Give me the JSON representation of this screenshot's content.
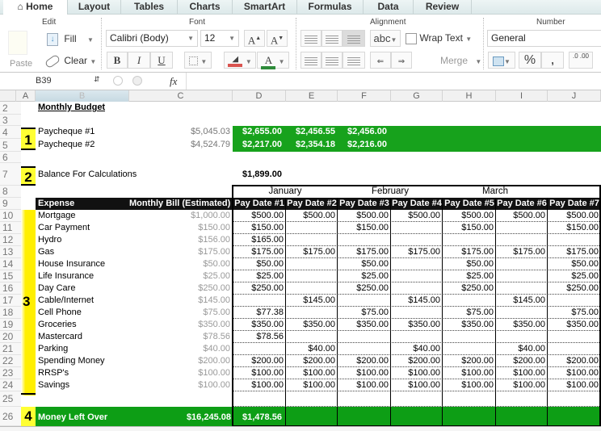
{
  "tabs": [
    {
      "label": "Home",
      "icon": "home-icon",
      "active": true
    },
    {
      "label": "Layout"
    },
    {
      "label": "Tables"
    },
    {
      "label": "Charts"
    },
    {
      "label": "SmartArt"
    },
    {
      "label": "Formulas"
    },
    {
      "label": "Data"
    },
    {
      "label": "Review"
    }
  ],
  "ribbon": {
    "edit": {
      "title": "Edit",
      "paste": "Paste",
      "fill": "Fill",
      "clear": "Clear"
    },
    "font": {
      "title": "Font",
      "font_name": "Calibri (Body)",
      "font_size": "12",
      "bold": "B",
      "italic": "I",
      "underline": "U",
      "grow": "A",
      "shrink": "A",
      "font_color": "A",
      "fill_color_hex": "#d9534f",
      "font_color_hex": "#2e8b3a"
    },
    "alignment": {
      "title": "Alignment",
      "orientation": "abc",
      "wrap_text": "Wrap Text",
      "merge": "Merge"
    },
    "number": {
      "title": "Number",
      "format": "General",
      "percent": "%",
      "comma": ",",
      "increase_decimal": ".0 .00"
    }
  },
  "formula_bar": {
    "name_box": "B39",
    "fx": "fx",
    "formula": ""
  },
  "columns": [
    "A",
    "B",
    "C",
    "D",
    "E",
    "F",
    "G",
    "H",
    "I",
    "J"
  ],
  "rows": [
    "2",
    "3",
    "4",
    "5",
    "6",
    "7",
    "8",
    "9",
    "10",
    "11",
    "12",
    "13",
    "14",
    "15",
    "16",
    "17",
    "18",
    "19",
    "20",
    "21",
    "22",
    "23",
    "24",
    "25",
    "26"
  ],
  "sheet": {
    "title": "Monthly Budget",
    "badges": [
      "1",
      "2",
      "3",
      "4"
    ],
    "paycheques": [
      {
        "label": "Paycheque #1",
        "total": "$5,045.03",
        "values": [
          "$2,655.00",
          "$2,456.55",
          "$2,456.00"
        ]
      },
      {
        "label": "Paycheque #2",
        "total": "$4,524.79",
        "values": [
          "$2,217.00",
          "$2,354.18",
          "$2,216.00"
        ]
      }
    ],
    "balance": {
      "label": "Balance For Calculations",
      "value": "$1,899.00"
    },
    "months": [
      "January",
      "February",
      "March"
    ],
    "header": {
      "expense": "Expense",
      "monthly_bill": "Monthly Bill (Estimated)",
      "pay_dates": [
        "Pay Date #1",
        "Pay Date #2",
        "Pay Date #3",
        "Pay Date #4",
        "Pay Date #5",
        "Pay Date #6",
        "Pay Date #7"
      ]
    },
    "expenses": [
      {
        "name": "Mortgage",
        "bill": "$1,000.00",
        "pays": [
          "$500.00",
          "$500.00",
          "$500.00",
          "$500.00",
          "$500.00",
          "$500.00",
          "$500.00"
        ]
      },
      {
        "name": "Car Payment",
        "bill": "$150.00",
        "pays": [
          "$150.00",
          "",
          "$150.00",
          "",
          "$150.00",
          "",
          "$150.00"
        ]
      },
      {
        "name": "Hydro",
        "bill": "$156.00",
        "pays": [
          "$165.00",
          "",
          "",
          "",
          "",
          "",
          ""
        ]
      },
      {
        "name": "Gas",
        "bill": "$175.00",
        "pays": [
          "$175.00",
          "$175.00",
          "$175.00",
          "$175.00",
          "$175.00",
          "$175.00",
          "$175.00"
        ]
      },
      {
        "name": "House Insurance",
        "bill": "$50.00",
        "pays": [
          "$50.00",
          "",
          "$50.00",
          "",
          "$50.00",
          "",
          "$50.00"
        ]
      },
      {
        "name": "Life Insurance",
        "bill": "$25.00",
        "pays": [
          "$25.00",
          "",
          "$25.00",
          "",
          "$25.00",
          "",
          "$25.00"
        ]
      },
      {
        "name": "Day Care",
        "bill": "$250.00",
        "pays": [
          "$250.00",
          "",
          "$250.00",
          "",
          "$250.00",
          "",
          "$250.00"
        ]
      },
      {
        "name": "Cable/Internet",
        "bill": "$145.00",
        "pays": [
          "",
          "$145.00",
          "",
          "$145.00",
          "",
          "$145.00",
          ""
        ]
      },
      {
        "name": "Cell Phone",
        "bill": "$75.00",
        "pays": [
          "$77.38",
          "",
          "$75.00",
          "",
          "$75.00",
          "",
          "$75.00"
        ]
      },
      {
        "name": "Groceries",
        "bill": "$350.00",
        "pays": [
          "$350.00",
          "$350.00",
          "$350.00",
          "$350.00",
          "$350.00",
          "$350.00",
          "$350.00"
        ]
      },
      {
        "name": "Mastercard",
        "bill": "$78.56",
        "pays": [
          "$78.56",
          "",
          "",
          "",
          "",
          "",
          ""
        ]
      },
      {
        "name": "Parking",
        "bill": "$40.00",
        "pays": [
          "",
          "$40.00",
          "",
          "$40.00",
          "",
          "$40.00",
          ""
        ]
      },
      {
        "name": "Spending Money",
        "bill": "$200.00",
        "pays": [
          "$200.00",
          "$200.00",
          "$200.00",
          "$200.00",
          "$200.00",
          "$200.00",
          "$200.00"
        ]
      },
      {
        "name": "RRSP's",
        "bill": "$100.00",
        "pays": [
          "$100.00",
          "$100.00",
          "$100.00",
          "$100.00",
          "$100.00",
          "$100.00",
          "$100.00"
        ]
      },
      {
        "name": "Savings",
        "bill": "$100.00",
        "pays": [
          "$100.00",
          "$100.00",
          "$100.00",
          "$100.00",
          "$100.00",
          "$100.00",
          "$100.00"
        ]
      }
    ],
    "left_over": {
      "label": "Money Left Over",
      "total": "$16,245.08",
      "values": [
        "$1,478.56",
        "",
        "",
        "",
        "",
        "",
        ""
      ]
    }
  }
}
